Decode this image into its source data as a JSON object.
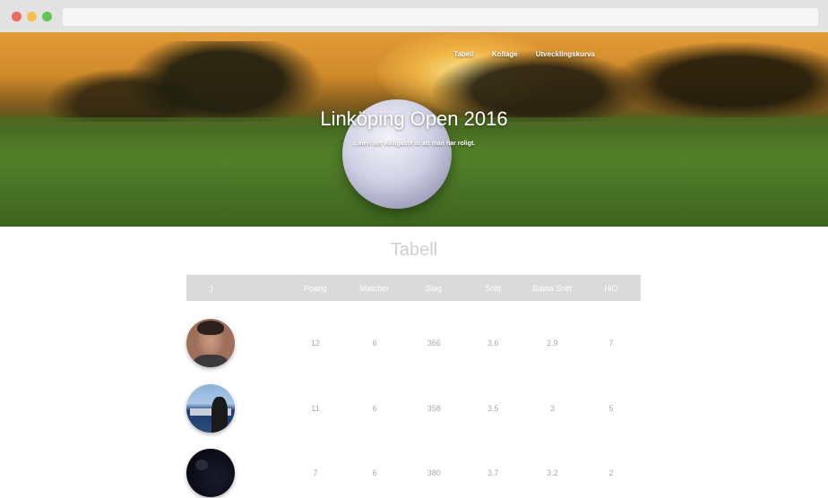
{
  "nav": {
    "items": [
      "Tabell",
      "Kollage",
      "Utvecklingskurva"
    ]
  },
  "hero": {
    "title": "Linköping Open 2016",
    "tagline": "...men det viktigaste är att man har roligt."
  },
  "section": {
    "title": "Tabell"
  },
  "table": {
    "headers": [
      ":)",
      "Poäng",
      "Matcher",
      "Slag",
      "Snitt",
      "Bästa Snitt",
      "HiO"
    ],
    "rows": [
      {
        "poang": "12",
        "matcher": "6",
        "slag": "366",
        "snitt": "3.6",
        "basta": "2.9",
        "hio": "7"
      },
      {
        "poang": "11",
        "matcher": "6",
        "slag": "358",
        "snitt": "3.5",
        "basta": "3",
        "hio": "5"
      },
      {
        "poang": "7",
        "matcher": "6",
        "slag": "380",
        "snitt": "3.7",
        "basta": "3.2",
        "hio": "2"
      }
    ]
  },
  "colors": {
    "header_bg": "#dadada",
    "cell_text": "#a9a9a9",
    "title_text": "#cfcfcf"
  }
}
